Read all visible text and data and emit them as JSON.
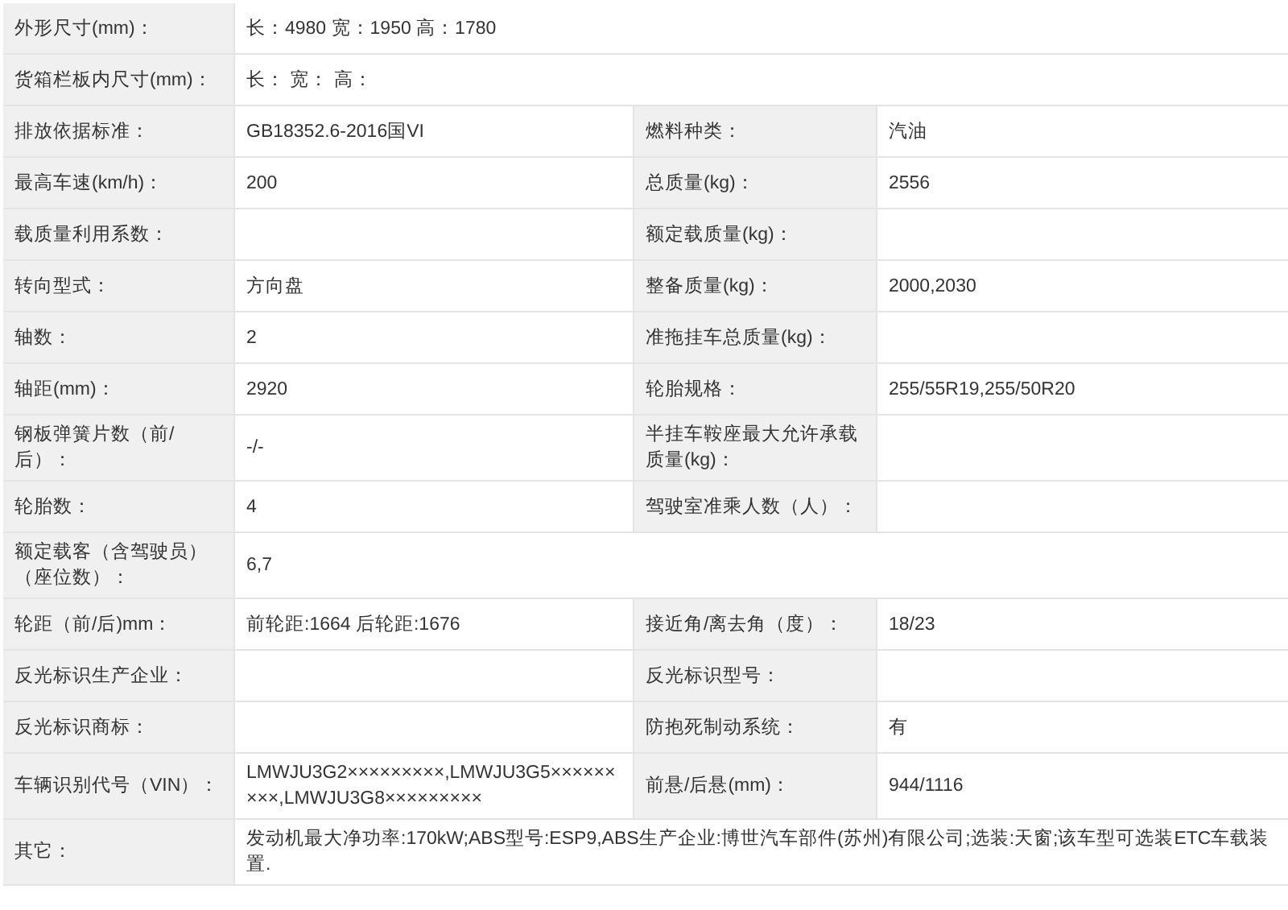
{
  "rows": [
    {
      "pairs": [
        {
          "label": "外形尺寸(mm)：",
          "value": "长：4980 宽：1950 高：1780"
        }
      ]
    },
    {
      "pairs": [
        {
          "label": "货箱栏板内尺寸(mm)：",
          "value": "长： 宽： 高："
        }
      ]
    },
    {
      "pairs": [
        {
          "label": "排放依据标准：",
          "value": "GB18352.6-2016国VI"
        },
        {
          "label": "燃料种类：",
          "value": "汽油"
        }
      ]
    },
    {
      "pairs": [
        {
          "label": "最高车速(km/h)：",
          "value": "200"
        },
        {
          "label": "总质量(kg)：",
          "value": "2556"
        }
      ]
    },
    {
      "pairs": [
        {
          "label": "载质量利用系数："
        },
        {
          "label": "额定载质量(kg)："
        }
      ]
    },
    {
      "pairs": [
        {
          "label": "转向型式：",
          "value": "方向盘"
        },
        {
          "label": "整备质量(kg)：",
          "value": "2000,2030"
        }
      ]
    },
    {
      "pairs": [
        {
          "label": "轴数：",
          "value": "2"
        },
        {
          "label": "准拖挂车总质量(kg)："
        }
      ]
    },
    {
      "pairs": [
        {
          "label": "轴距(mm)：",
          "value": "2920"
        },
        {
          "label": "轮胎规格：",
          "value": "255/55R19,255/50R20"
        }
      ]
    },
    {
      "pairs": [
        {
          "label": "钢板弹簧片数（前/后）：",
          "value": "-/-"
        },
        {
          "label": "半挂车鞍座最大允许承载质量(kg)："
        }
      ]
    },
    {
      "pairs": [
        {
          "label": "轮胎数：",
          "value": "4"
        },
        {
          "label": "驾驶室准乘人数（人）："
        }
      ]
    },
    {
      "pairs": [
        {
          "label": "额定载客（含驾驶员）（座位数）：",
          "value": "6,7"
        }
      ]
    },
    {
      "pairs": [
        {
          "label": "轮距（前/后)mm：",
          "value": "前轮距:1664 后轮距:1676"
        },
        {
          "label": "接近角/离去角（度）：",
          "value": "18/23"
        }
      ]
    },
    {
      "pairs": [
        {
          "label": "反光标识生产企业："
        },
        {
          "label": "反光标识型号："
        }
      ]
    },
    {
      "pairs": [
        {
          "label": "反光标识商标："
        },
        {
          "label": "防抱死制动系统：",
          "value": "有"
        }
      ]
    },
    {
      "pairs": [
        {
          "label": "车辆识别代号（VIN）：",
          "value": "LMWJU3G2×××××××××,LMWJU3G5×××××××××,LMWJU3G8×××××××××"
        },
        {
          "label": "前悬/后悬(mm)：",
          "value": "944/1116"
        }
      ]
    },
    {
      "pairs": [
        {
          "label": "其它：",
          "value": "发动机最大净功率:170kW;ABS型号:ESP9,ABS生产企业:博世汽车部件(苏州)有限公司;选装:天窗;该车型可选装ETC车载装置."
        }
      ]
    }
  ]
}
